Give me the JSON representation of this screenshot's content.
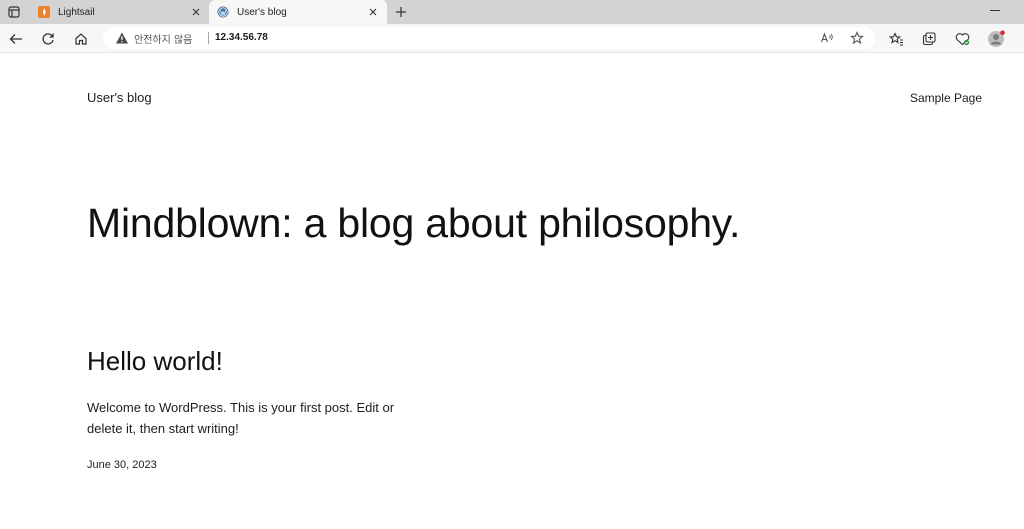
{
  "browser": {
    "tabs": [
      {
        "label": "Lightsail",
        "active": false,
        "favicon": "lightsail-icon",
        "favicon_color": "#e8812c"
      },
      {
        "label": "User's blog",
        "active": true,
        "favicon": "wordpress-icon",
        "favicon_color": "#3a6fa5"
      }
    ],
    "address_bar": {
      "security_text": "안전하지 않음",
      "url": "12.34.56.78"
    },
    "colors": {
      "tabstrip": "#d3d3d3",
      "toolbar": "#f7f7f7",
      "notification_dot": "#e0262b"
    }
  },
  "page": {
    "site_title": "User's blog",
    "nav_link": "Sample Page",
    "tagline": "Mindblown: a blog about philosophy.",
    "post": {
      "title": "Hello world!",
      "excerpt": "Welcome to WordPress. This is your first post. Edit or delete it, then start writing!",
      "date": "June 30, 2023"
    }
  }
}
